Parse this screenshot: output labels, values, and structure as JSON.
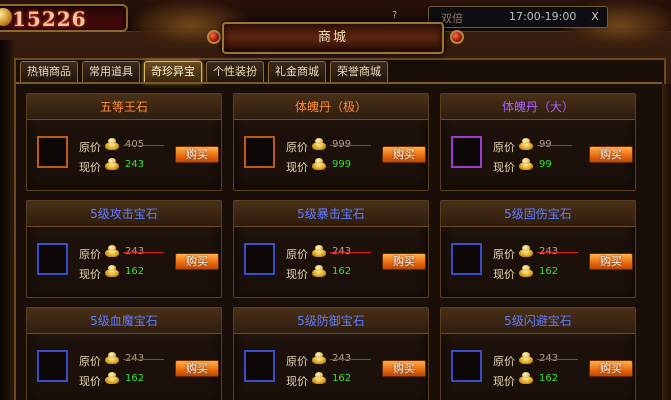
{
  "top_bar": {
    "gold_amount": "15226",
    "time_prefix": "双倍",
    "time_range": "17:00-19:00",
    "close_glyph": "X",
    "small_glyph": "?"
  },
  "window": {
    "title": "商城"
  },
  "tabs": [
    {
      "label": "热销商品",
      "active": false
    },
    {
      "label": "常用道具",
      "active": false
    },
    {
      "label": "奇珍异宝",
      "active": true
    },
    {
      "label": "个性装扮",
      "active": false
    },
    {
      "label": "礼金商城",
      "active": false
    },
    {
      "label": "荣誉商城",
      "active": false
    }
  ],
  "labels": {
    "original_price": "原价",
    "current_price": "现价",
    "buy": "购买"
  },
  "items": [
    {
      "name": "五等王石",
      "color": "orange",
      "original": "405",
      "current": "243"
    },
    {
      "name": "体魄丹（极）",
      "color": "orange",
      "original": "999",
      "current": "999"
    },
    {
      "name": "体魄丹（大）",
      "color": "purple",
      "original": "99",
      "current": "99"
    },
    {
      "name": "5级攻击宝石",
      "color": "blue",
      "original": "243",
      "current": "162"
    },
    {
      "name": "5级暴击宝石",
      "color": "blue",
      "original": "243",
      "current": "162"
    },
    {
      "name": "5级固伤宝石",
      "color": "blue",
      "original": "243",
      "current": "162"
    },
    {
      "name": "5级血魔宝石",
      "color": "blue",
      "original": "243",
      "current": "162"
    },
    {
      "name": "5级防御宝石",
      "color": "blue",
      "original": "243",
      "current": "162"
    },
    {
      "name": "5级闪避宝石",
      "color": "blue",
      "original": "243",
      "current": "162"
    }
  ],
  "colors": {
    "orange": "#ff8a3c",
    "purple": "#a860ff",
    "blue": "#5f7cff",
    "buy_button": "#e86a10",
    "current_price": "#3ae03a",
    "strike": "#e02020"
  },
  "icons": {
    "currency": "gold-ingot-icon",
    "gold_counter": "gold-coin-icon"
  }
}
